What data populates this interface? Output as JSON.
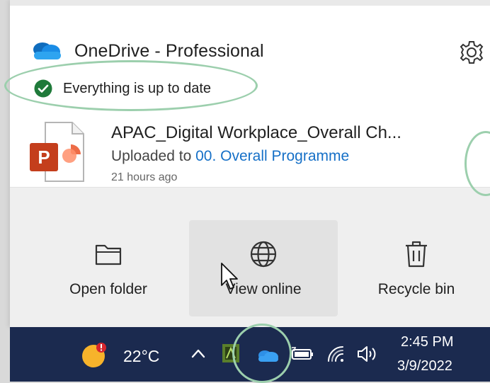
{
  "header": {
    "app_title": "OneDrive - Professional",
    "logo_icon": "onedrive-cloud-icon",
    "settings_icon": "gear-icon"
  },
  "status": {
    "text": "Everything is up to date",
    "icon": "check-circle-icon",
    "color": "#1f7a3a"
  },
  "recent_file": {
    "name": "APAC_Digital Workplace_Overall Ch...",
    "uploaded_prefix": "Uploaded to",
    "uploaded_location": "00. Overall Programme",
    "time_ago": "21 hours ago",
    "icon": "powerpoint-file-icon"
  },
  "actions": [
    {
      "label": "Open folder",
      "icon": "folder-icon"
    },
    {
      "label": "View online",
      "icon": "globe-icon"
    },
    {
      "label": "Recycle bin",
      "icon": "trash-icon"
    }
  ],
  "taskbar": {
    "temperature": "22°C",
    "time": "2:45 PM",
    "date": "3/9/2022"
  },
  "colors": {
    "accent": "#1670c7",
    "taskbar": "#1b2a4f",
    "highlight": "#9ccfad"
  }
}
